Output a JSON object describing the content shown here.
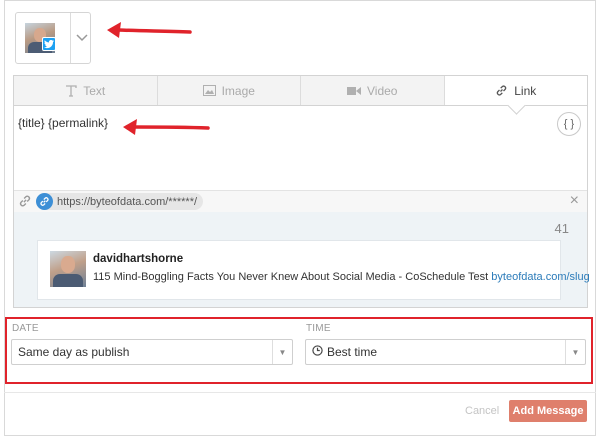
{
  "account": {
    "network_icon": "twitter-icon",
    "dropdown_icon": "chevron-down-icon"
  },
  "tabs": [
    {
      "label": "Text",
      "icon": "text-icon",
      "active": false
    },
    {
      "label": "Image",
      "icon": "image-icon",
      "active": false
    },
    {
      "label": "Video",
      "icon": "video-icon",
      "active": false
    },
    {
      "label": "Link",
      "icon": "link-icon",
      "active": true
    }
  ],
  "composer": {
    "message": "{title} {permalink}",
    "variables_button": "{ }"
  },
  "link": {
    "url": "https://byteofdata.com/******/",
    "remove_icon": "×"
  },
  "preview": {
    "char_count": "41",
    "username": "davidhartshorne",
    "text": "115 Mind-Boggling Facts You Never Knew About Social Media - CoSchedule Test ",
    "link_text": "byteofdata.com/slug"
  },
  "schedule": {
    "date_label": "DATE",
    "date_value": "Same day as publish",
    "time_label": "TIME",
    "time_value": "Best time"
  },
  "footer": {
    "cancel_label": "Cancel",
    "add_label": "Add Message"
  },
  "colors": {
    "highlight": "#e0232b",
    "primary_button": "#df7f6c",
    "link": "#2b7bb9",
    "twitter": "#1da1f2"
  }
}
